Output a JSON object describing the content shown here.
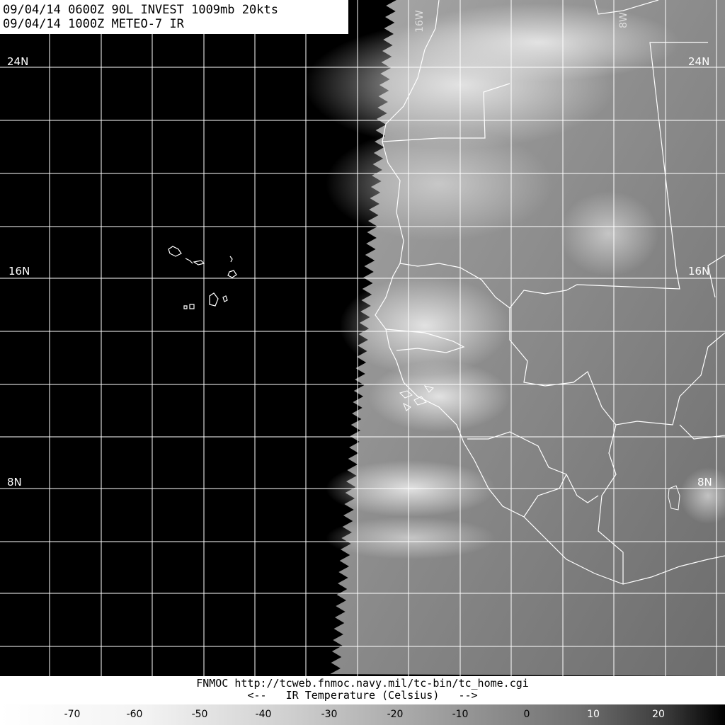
{
  "header": {
    "line1": "09/04/14 0600Z  90L INVEST 1009mb 20kts",
    "line2": "09/04/14 1000Z  METEO-7 IR"
  },
  "lat_labels": [
    "24N",
    "24N",
    "16N",
    "16N",
    "8N",
    "8N"
  ],
  "lon_labels": [
    "16W",
    "8W"
  ],
  "footer": {
    "credit": "FNMOC http://tcweb.fnmoc.navy.mil/tc-bin/tc_home.cgi",
    "legend_title": "<--   IR Temperature (Celsius)   -->",
    "ticks": [
      "-70",
      "-60",
      "-50",
      "-40",
      "-30",
      "-20",
      "-10",
      "0",
      "10",
      "20"
    ]
  },
  "colors": {
    "ocean_space": "#000000",
    "cloud_bright": "#dcdcdc",
    "land_mid": "#7d7d7d",
    "grid": "#ffffff",
    "coastline": "#ffffff"
  }
}
